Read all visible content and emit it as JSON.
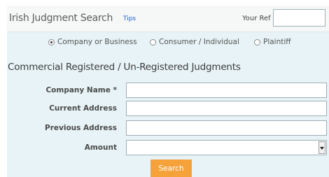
{
  "header": {
    "title": "Irish Judgment Search",
    "tips_link": "Tips",
    "your_ref_label": "Your Ref",
    "your_ref_value": ""
  },
  "search_type": {
    "options": [
      {
        "label": "Company or Business",
        "selected": true
      },
      {
        "label": "Consumer / Individual",
        "selected": false
      },
      {
        "label": "Plaintiff",
        "selected": false
      }
    ]
  },
  "form": {
    "section_title": "Commercial Registered / Un-Registered Judgments",
    "fields": [
      {
        "label": "Company Name *",
        "value": ""
      },
      {
        "label": "Current Address",
        "value": ""
      },
      {
        "label": "Previous Address",
        "value": ""
      }
    ],
    "amount": {
      "label": "Amount",
      "selected_value": ""
    },
    "search_button": "Search"
  },
  "colors": {
    "panel_background": "#e7f3f6",
    "header_background": "#f6f8f8",
    "link": "#1b5fc9",
    "search_button": "#f6a23b"
  }
}
